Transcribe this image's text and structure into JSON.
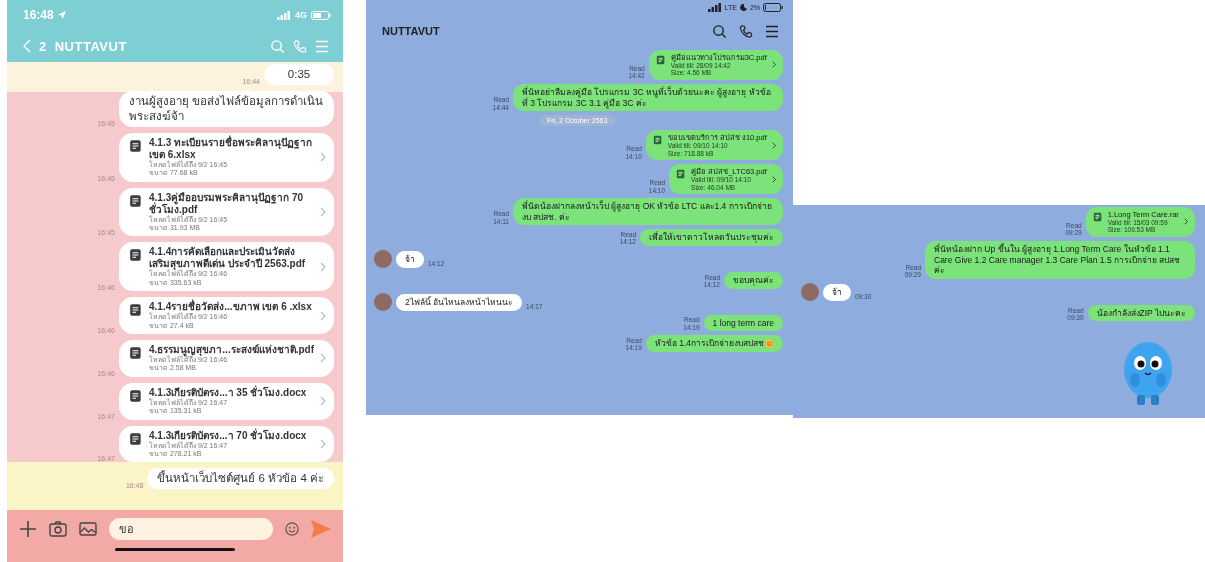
{
  "screens": [
    {
      "kind": "pastel",
      "status_bar": {
        "time": "16:48",
        "network": "4G"
      },
      "header": {
        "back_count": "2",
        "title": "NUTTAVUT"
      },
      "messages": [
        {
          "kind": "voice",
          "incoming": false,
          "text": "0:35",
          "time": "16:44"
        },
        {
          "kind": "text",
          "incoming": false,
          "text": "งานผู้สูงอายุ ขอส่งไฟล์ข้อมูลการดำเนินพระสงฆ์จ้า",
          "time": "16:45"
        },
        {
          "kind": "file",
          "incoming": false,
          "name": "4.1.3 ทะเบียนรายชื่อพระคิลานุปัฏฐาก เขต 6.xlsx",
          "expiry": "โหลดไฟล์ได้ถึง 9/2 16:45",
          "size": "ขนาด 77.68 kB",
          "time": "16:45"
        },
        {
          "kind": "file",
          "incoming": false,
          "name": "4.1.3คู่มืออบรมพระคิลานุปัฏฐาก 70 ชั่วโมง.pdf",
          "expiry": "โหลดไฟล์ได้ถึง 9/2 16:45",
          "size": "ขนาด 31.93 MB",
          "time": "16:45"
        },
        {
          "kind": "file",
          "incoming": false,
          "name": "4.1.4การคัดเลือกและประเมินวัดส่งเสริมสุขภาพดีเด่น ประจำปี 2563.pdf",
          "expiry": "โหลดไฟล์ได้ถึง 9/2 16:46",
          "size": "ขนาด 335.63 kB",
          "time": "16:46"
        },
        {
          "kind": "file",
          "incoming": false,
          "name": "4.1.4รายชื่อวัดส่ง...ขภาพ เขต 6 .xlsx",
          "expiry": "โหลดไฟล์ได้ถึง 9/2 16:46",
          "size": "ขนาด 27.4 kB",
          "time": "16:46"
        },
        {
          "kind": "file",
          "incoming": false,
          "name": "4.ธรรมนูญสุขภา...ระสงฆ์แห่งชาติ.pdf",
          "expiry": "โหลดไฟล์ได้ถึง 9/2 16:46",
          "size": "ขนาด 2.58 MB",
          "time": "16:46"
        },
        {
          "kind": "file",
          "incoming": false,
          "name": "4.1.3เกียรติบัตรง...า 35 ชั่วโมง.docx",
          "expiry": "โหลดไฟล์ได้ถึง 9/2 16:47",
          "size": "ขนาด 135.31 kB",
          "time": "16:47"
        },
        {
          "kind": "file",
          "incoming": false,
          "name": "4.1.3เกียรติบัตรง...า 70 ชั่วโมง.docx",
          "expiry": "โหลดไฟล์ได้ถึง 9/2 16:47",
          "size": "ขนาด 278.21 kB",
          "time": "16:47"
        },
        {
          "kind": "text",
          "incoming": false,
          "text": "ขึ้นหน้าเว็บไซต์ศูนย์ 6 หัวข้อ 4 ค่ะ",
          "time": "16:48"
        }
      ],
      "composer": {
        "value": "ขอ"
      }
    },
    {
      "kind": "blue",
      "status_bar": {
        "network": "LTE",
        "battery": "2%"
      },
      "header": {
        "title": "NUTTAVUT"
      },
      "messages": [
        {
          "kind": "file",
          "incoming": false,
          "name": "คู่มือแนวทางโปรแกรม3C.pdf",
          "expiry": "Valid till: 28/09 14:42",
          "size": "Size: 4.56 MB",
          "status": "Read",
          "time": "14:42"
        },
        {
          "kind": "text",
          "incoming": false,
          "text": "พี่นัทอย่าลืมลงคู่มือ โปรแกรม 3C หนูที่เว็บด้วยนะคะ ผู้สูงอายุ หัวข้อที่ 3 โปรแกรม 3C      3.1 คู่มือ 3C ค่ะ",
          "status": "Read",
          "time": "14:44"
        },
        {
          "kind": "date",
          "text": "Fri, 2 October 2563"
        },
        {
          "kind": "file",
          "incoming": false,
          "name": "ขอบเขตบริการ สปสช ง10.pdf",
          "expiry": "Valid till: 09/10 14:10",
          "size": "Size: 718.88 kB",
          "status": "Read",
          "time": "14:10"
        },
        {
          "kind": "file",
          "incoming": false,
          "name": "คู่มือ สปสช_LTC63.pdf",
          "expiry": "Valid till: 09/10 14:10",
          "size": "Size: 46.04 MB",
          "status": "Read",
          "time": "14:10"
        },
        {
          "kind": "text",
          "incoming": false,
          "text": "พี่นัดน้องฝากลงหน้าเว็ป ผู้สูงอายุ OK  หัวข้อ LTC และ1.4 การเบิกจ่ายงบ สปสช. ค่ะ",
          "status": "Read",
          "time": "14:11"
        },
        {
          "kind": "text",
          "incoming": false,
          "text": "เพื่อให้เขาดาวโหลดวันประชุมค่ะ",
          "status": "Read",
          "time": "14:12"
        },
        {
          "kind": "text",
          "incoming": true,
          "text": "จ้า",
          "time": "14:12"
        },
        {
          "kind": "text",
          "incoming": false,
          "text": "ขอบคุณค่ะ",
          "status": "Read",
          "time": "14:12"
        },
        {
          "kind": "text",
          "incoming": true,
          "text": "2ไฟล์นี้ อันไหนลงหน้าไหนนะ",
          "time": "14:17"
        },
        {
          "kind": "text",
          "incoming": false,
          "text": "1 long term care",
          "status": "Read",
          "time": "14:19"
        },
        {
          "kind": "text",
          "incoming": false,
          "text": "หัวข้อ 1.4การเบิกจ่ายงบสปสช",
          "emoji": true,
          "status": "Read",
          "time": "14:19"
        }
      ]
    },
    {
      "kind": "blue",
      "messages": [
        {
          "kind": "file",
          "incoming": false,
          "name": "1.Long Term Care.rar",
          "expiry": "Valid till: 15/03 09:59",
          "size": "Size: 109.53 MB",
          "status": "Read",
          "time": "09:29"
        },
        {
          "kind": "text",
          "incoming": false,
          "text": "พี่นัทน้องฝาก Up ขึ้นใน ผู้สูงอายุ 1.Long Term Care ในหัวข้อ 1.1 Care Give 1.2 Care manager 1.3 Care Plan 1.5 การเบิกจ่าย สปสช ค่ะ",
          "status": "Read",
          "time": "09:29"
        },
        {
          "kind": "text",
          "incoming": true,
          "text": "จ้า",
          "time": "09:30"
        },
        {
          "kind": "text",
          "incoming": false,
          "text": "น้องกำลังส่งZIP ไปนะคะ",
          "status": "Read",
          "time": "09:30"
        },
        {
          "kind": "sticker"
        }
      ]
    }
  ]
}
